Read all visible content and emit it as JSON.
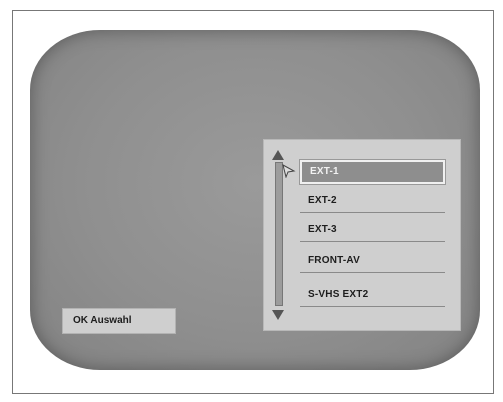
{
  "menu": {
    "items": [
      {
        "label": "EXT-1",
        "selected": true
      },
      {
        "label": "EXT-2",
        "selected": false
      },
      {
        "label": "EXT-3",
        "selected": false
      },
      {
        "label": "FRONT-AV",
        "selected": false
      },
      {
        "label": "S-VHS EXT2",
        "selected": false
      }
    ]
  },
  "hint": {
    "label": "OK Auswahl"
  },
  "icons": {
    "scroll_up": "triangle-up-icon",
    "scroll_down": "triangle-down-icon",
    "cursor": "selection-pointer-icon"
  },
  "colors": {
    "screen": "#909090",
    "panel": "#cfcfcf",
    "selected_item": "#8e8e8e"
  }
}
